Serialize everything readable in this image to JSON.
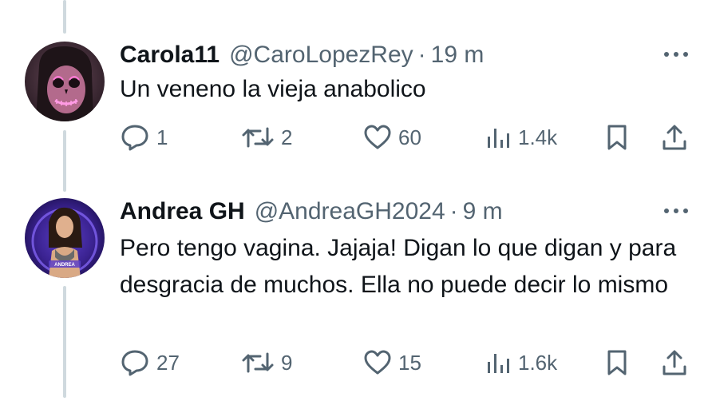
{
  "colors": {
    "text": "#0f1419",
    "secondary": "#536471",
    "thread_line": "#cfd9de"
  },
  "tweets": [
    {
      "author_name": "Carola11",
      "handle": "@CaroLopezRey",
      "separator": "·",
      "time": "19 m",
      "text": "Un veneno la vieja anabolico",
      "replies": "1",
      "retweets": "2",
      "likes": "60",
      "views": "1.4k",
      "avatar": "skull-makeup-avatar"
    },
    {
      "author_name": "Andrea GH",
      "handle": "@AndreaGH2024",
      "separator": "·",
      "time": "9 m",
      "text": "Pero tengo vagina. Jajaja! Digan lo que digan y para desgracia de muchos. Ella no puede decir lo mismo",
      "replies": "27",
      "retweets": "9",
      "likes": "15",
      "views": "1.6k",
      "avatar": "woman-portrait-avatar",
      "avatar_caption": "ANDREA"
    }
  ],
  "icons": [
    "reply-icon",
    "retweet-icon",
    "like-icon",
    "views-icon",
    "bookmark-icon",
    "share-icon",
    "more-icon"
  ]
}
